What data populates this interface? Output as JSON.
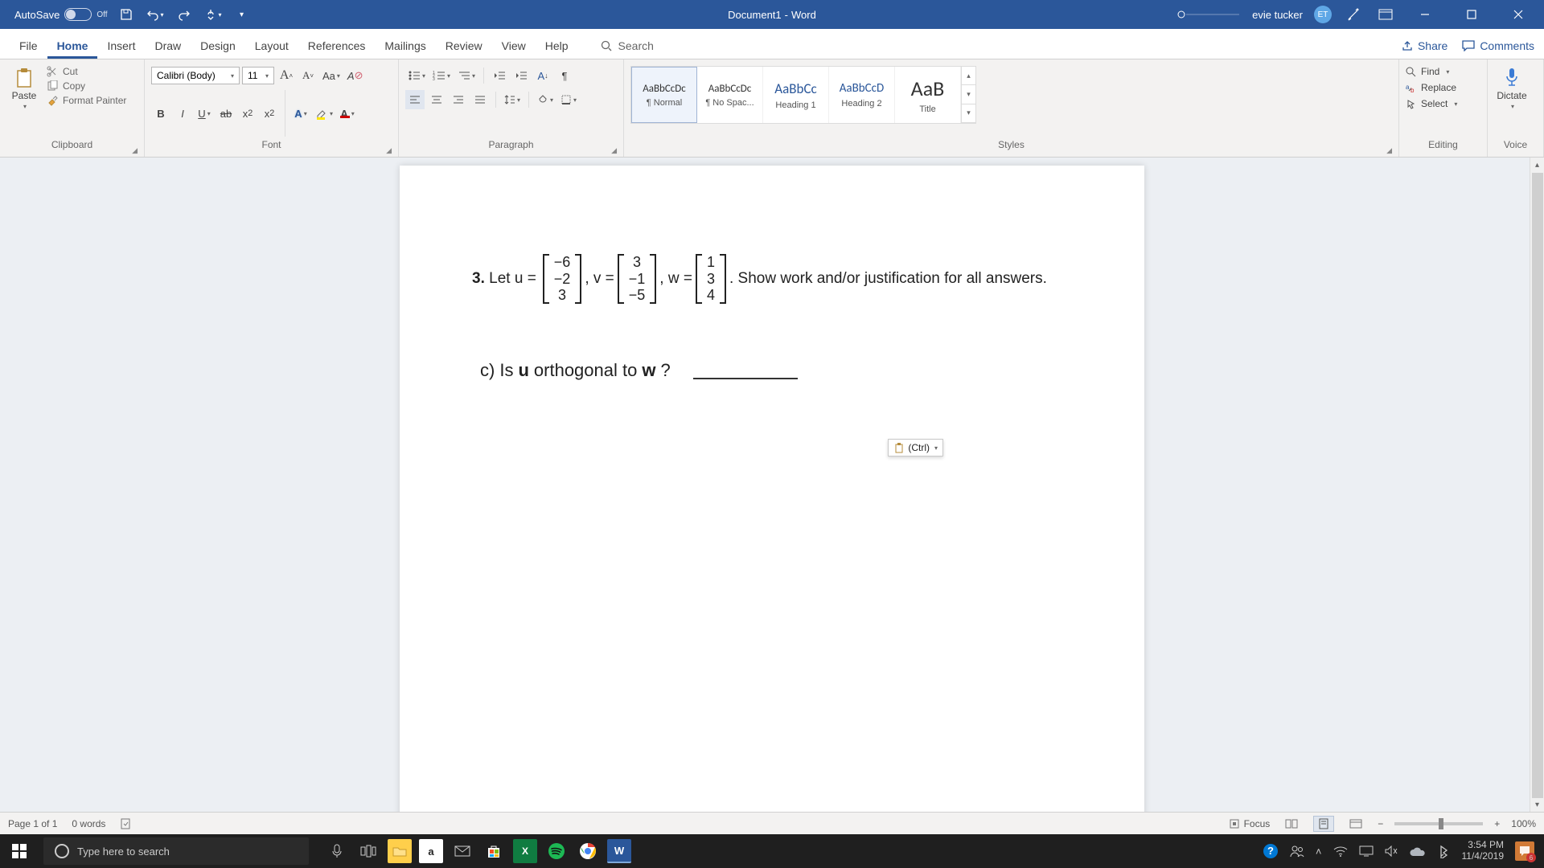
{
  "titlebar": {
    "autosave_label": "AutoSave",
    "autosave_state": "Off",
    "doc_title": "Document1",
    "app_name": "Word",
    "user_name": "evie tucker",
    "user_initials": "ET"
  },
  "tabs": {
    "items": [
      "File",
      "Home",
      "Insert",
      "Draw",
      "Design",
      "Layout",
      "References",
      "Mailings",
      "Review",
      "View",
      "Help"
    ],
    "active_index": 1,
    "search_placeholder": "Search",
    "share": "Share",
    "comments": "Comments"
  },
  "ribbon": {
    "clipboard": {
      "paste": "Paste",
      "cut": "Cut",
      "copy": "Copy",
      "format_painter": "Format Painter",
      "label": "Clipboard"
    },
    "font": {
      "name": "Calibri (Body)",
      "size": "11",
      "label": "Font"
    },
    "paragraph": {
      "label": "Paragraph"
    },
    "styles": {
      "label": "Styles",
      "items": [
        {
          "preview": "AaBbCcDc",
          "name": "¶ Normal",
          "size": "13px",
          "color": "#333"
        },
        {
          "preview": "AaBbCcDc",
          "name": "¶ No Spac...",
          "size": "13px",
          "color": "#333"
        },
        {
          "preview": "AaBbCc",
          "name": "Heading 1",
          "size": "17px",
          "color": "#2b579a"
        },
        {
          "preview": "AaBbCcD",
          "name": "Heading 2",
          "size": "15px",
          "color": "#2b579a"
        },
        {
          "preview": "AaB",
          "name": "Title",
          "size": "26px",
          "color": "#333"
        }
      ]
    },
    "editing": {
      "find": "Find",
      "replace": "Replace",
      "select": "Select",
      "label": "Editing"
    },
    "voice": {
      "dictate": "Dictate",
      "label": "Voice"
    }
  },
  "document": {
    "problem_number": "3.",
    "let": "Let",
    "u_label": "u =",
    "v_label": ", v =",
    "w_label": ", w =",
    "u": [
      "−6",
      "−2",
      "3"
    ],
    "v": [
      "3",
      "−1",
      "−5"
    ],
    "w": [
      "1",
      "3",
      "4"
    ],
    "tail": ". Show work and/or justification for all answers.",
    "question_label": "c)",
    "question_text_1": "Is",
    "question_u": "u",
    "question_text_2": "orthogonal to",
    "question_w": "w",
    "question_q": "?",
    "paste_options": "(Ctrl)"
  },
  "statusbar": {
    "page": "Page 1 of 1",
    "words": "0 words",
    "focus": "Focus",
    "zoom": "100%"
  },
  "taskbar": {
    "search_placeholder": "Type here to search",
    "time": "3:54 PM",
    "date": "11/4/2019",
    "notif_count": "6"
  }
}
